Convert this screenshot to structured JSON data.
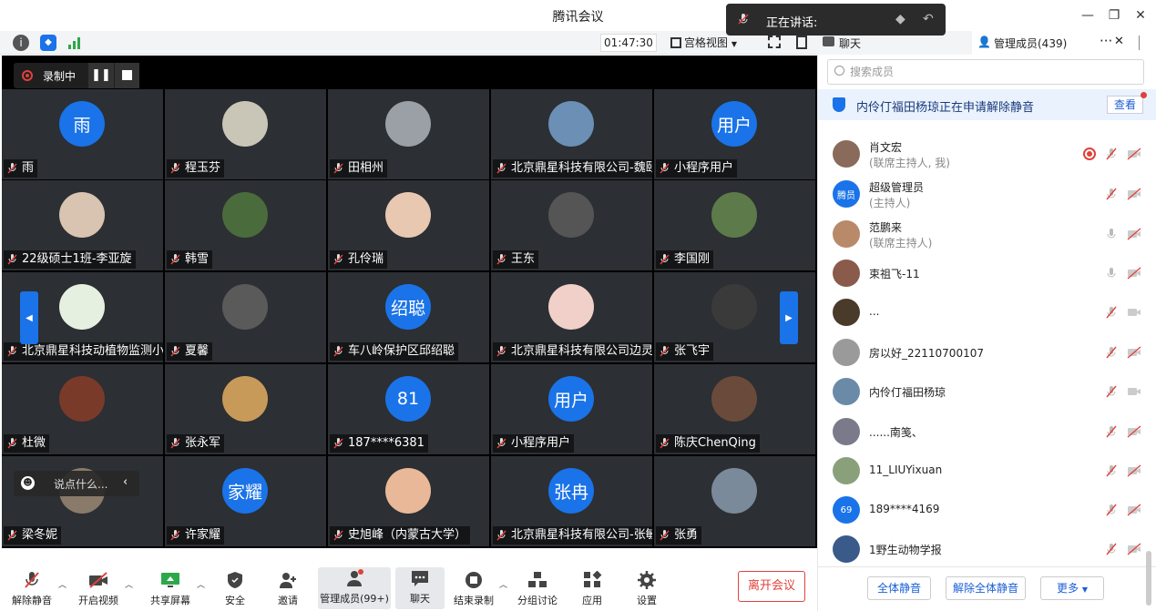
{
  "window": {
    "title": "腾讯会议"
  },
  "speaking": {
    "label": "正在讲话:"
  },
  "topbar": {
    "timer": "01:47:30",
    "view_label": "宫格视图"
  },
  "tabs": {
    "chat": "聊天",
    "members": "管理成员(439)"
  },
  "recording": {
    "label": "录制中"
  },
  "chat_input": {
    "placeholder": "说点什么..."
  },
  "tiles": [
    {
      "name": "雨",
      "avatar_text": "雨",
      "avatar_color": "#1a73e8"
    },
    {
      "name": "程玉芬",
      "avatar_text": "",
      "avatar_color": "#c9c6b8"
    },
    {
      "name": "田相州",
      "avatar_text": "",
      "avatar_color": "#9aa0a6"
    },
    {
      "name": "北京鼎星科技有限公司-魏颐",
      "avatar_text": "",
      "avatar_color": "#6b8fb5"
    },
    {
      "name": "小程序用户",
      "avatar_text": "用户",
      "avatar_color": "#1a73e8"
    },
    {
      "name": "22级硕士1班-李亚旋",
      "avatar_text": "",
      "avatar_color": "#d8c4b0"
    },
    {
      "name": "韩雪",
      "avatar_text": "",
      "avatar_color": "#4a6b3c"
    },
    {
      "name": "孔伶瑞",
      "avatar_text": "",
      "avatar_color": "#e8c8b0"
    },
    {
      "name": "王东",
      "avatar_text": "",
      "avatar_color": "#555555"
    },
    {
      "name": "李国刚",
      "avatar_text": "",
      "avatar_color": "#5d7a4a"
    },
    {
      "name": "北京鼎星科技动植物监测小C",
      "avatar_text": "",
      "avatar_color": "#e6f0e0"
    },
    {
      "name": "夏馨",
      "avatar_text": "",
      "avatar_color": "#5a5a5a"
    },
    {
      "name": "车八岭保护区邱绍聪",
      "avatar_text": "绍聪",
      "avatar_color": "#1a73e8"
    },
    {
      "name": "北京鼎星科技有限公司边灵",
      "avatar_text": "",
      "avatar_color": "#f0d0c8"
    },
    {
      "name": "张飞宇",
      "avatar_text": "",
      "avatar_color": "#3a3a3a"
    },
    {
      "name": "杜微",
      "avatar_text": "",
      "avatar_color": "#7a3a2a"
    },
    {
      "name": "张永军",
      "avatar_text": "",
      "avatar_color": "#c89a5a"
    },
    {
      "name": "187****6381",
      "avatar_text": "81",
      "avatar_color": "#1a73e8"
    },
    {
      "name": "小程序用户",
      "avatar_text": "用户",
      "avatar_color": "#1a73e8"
    },
    {
      "name": "陈庆ChenQing",
      "avatar_text": "",
      "avatar_color": "#6a4a3a"
    },
    {
      "name": "梁冬妮",
      "avatar_text": "",
      "avatar_color": "#8a7a6a"
    },
    {
      "name": "许家耀",
      "avatar_text": "家耀",
      "avatar_color": "#1a73e8"
    },
    {
      "name": "史旭峰（内蒙古大学）",
      "avatar_text": "",
      "avatar_color": "#e8b898"
    },
    {
      "name": "北京鼎星科技有限公司-张敏",
      "avatar_text": "张冉",
      "avatar_color": "#1a73e8"
    },
    {
      "name": "张勇",
      "avatar_text": "",
      "avatar_color": "#7a8a9a"
    }
  ],
  "panel": {
    "search_placeholder": "搜索成员",
    "notice_text": "内伶仃福田杨琼正在申请解除静音",
    "notice_button": "查看",
    "members": [
      {
        "name": "肖文宏",
        "role": "(联席主持人, 我)",
        "avatar_color": "#8a6a5a",
        "avatar_text": "",
        "recording": true
      },
      {
        "name": "超级管理员",
        "role": "(主持人)",
        "avatar_color": "#1a73e8",
        "avatar_text": "腾员"
      },
      {
        "name": "范鹏来",
        "role": "(联席主持人)",
        "avatar_color": "#b88a6a",
        "avatar_text": ""
      },
      {
        "name": "束祖飞-11",
        "role": "",
        "avatar_color": "#8a5a4a",
        "avatar_text": ""
      },
      {
        "name": "...",
        "role": "",
        "avatar_color": "#4a3a2a",
        "avatar_text": ""
      },
      {
        "name": "房以好_22110700107",
        "role": "",
        "avatar_color": "#9a9a9a",
        "avatar_text": ""
      },
      {
        "name": "内伶仃福田杨琼",
        "role": "",
        "avatar_color": "#6a8aa8",
        "avatar_text": ""
      },
      {
        "name": "......南笺、",
        "role": "",
        "avatar_color": "#7a7a8a",
        "avatar_text": ""
      },
      {
        "name": "11_LIUYixuan",
        "role": "",
        "avatar_color": "#8aa07a",
        "avatar_text": ""
      },
      {
        "name": "189****4169",
        "role": "",
        "avatar_color": "#1a73e8",
        "avatar_text": "69"
      },
      {
        "name": "1野生动物学报",
        "role": "",
        "avatar_color": "#3a5a8a",
        "avatar_text": ""
      }
    ],
    "buttons": {
      "mute_all": "全体静音",
      "unmute_all": "解除全体静音",
      "more": "更多"
    }
  },
  "bottombar": {
    "unmute": "解除静音",
    "video": "开启视频",
    "share": "共享屏幕",
    "security": "安全",
    "invite": "邀请",
    "members": "管理成员(99+)",
    "chat": "聊天",
    "stop_record": "结束录制",
    "breakout": "分组讨论",
    "apps": "应用",
    "settings": "设置",
    "leave": "离开会议"
  }
}
